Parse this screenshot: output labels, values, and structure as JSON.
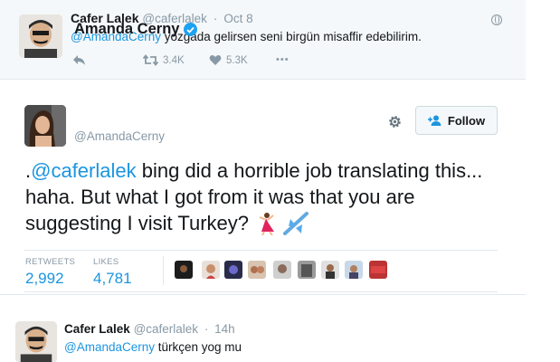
{
  "top_tweet": {
    "name": "Cafer Lalek",
    "handle": "@caferlalek",
    "separator": "·",
    "time": "Oct 8",
    "mention": "@AmandaCerny",
    "text": " yozgada gelirsen seni birgün misaffir edebilirim.",
    "retweets": "3.4K",
    "likes": "5.3K",
    "more": "•••"
  },
  "main_tweet": {
    "name": "Amanda Cerny",
    "handle": "@AmandaCerny",
    "follow_label": "Follow",
    "text_prefix": ".",
    "mention": "@caferlalek",
    "text": "  bing did a horrible job translating this... haha. But what I got from it was that you are suggesting I visit Turkey? ",
    "emojis": [
      "dancer-emoji",
      "airplane-emoji"
    ],
    "stats": {
      "retweets_label": "RETWEETS",
      "retweets_value": "2,992",
      "likes_label": "LIKES",
      "likes_value": "4,781"
    },
    "likers_count": 10
  },
  "bottom_tweet": {
    "name": "Cafer Lalek",
    "handle": "@caferlalek",
    "separator": "·",
    "time": "14h",
    "mention": "@AmandaCerny",
    "text": " türkçen yog mu"
  },
  "colors": {
    "link": "#1b95e0",
    "muted": "#8899a6",
    "verified": "#1da1f2",
    "top_bg": "#f5f8fa"
  }
}
